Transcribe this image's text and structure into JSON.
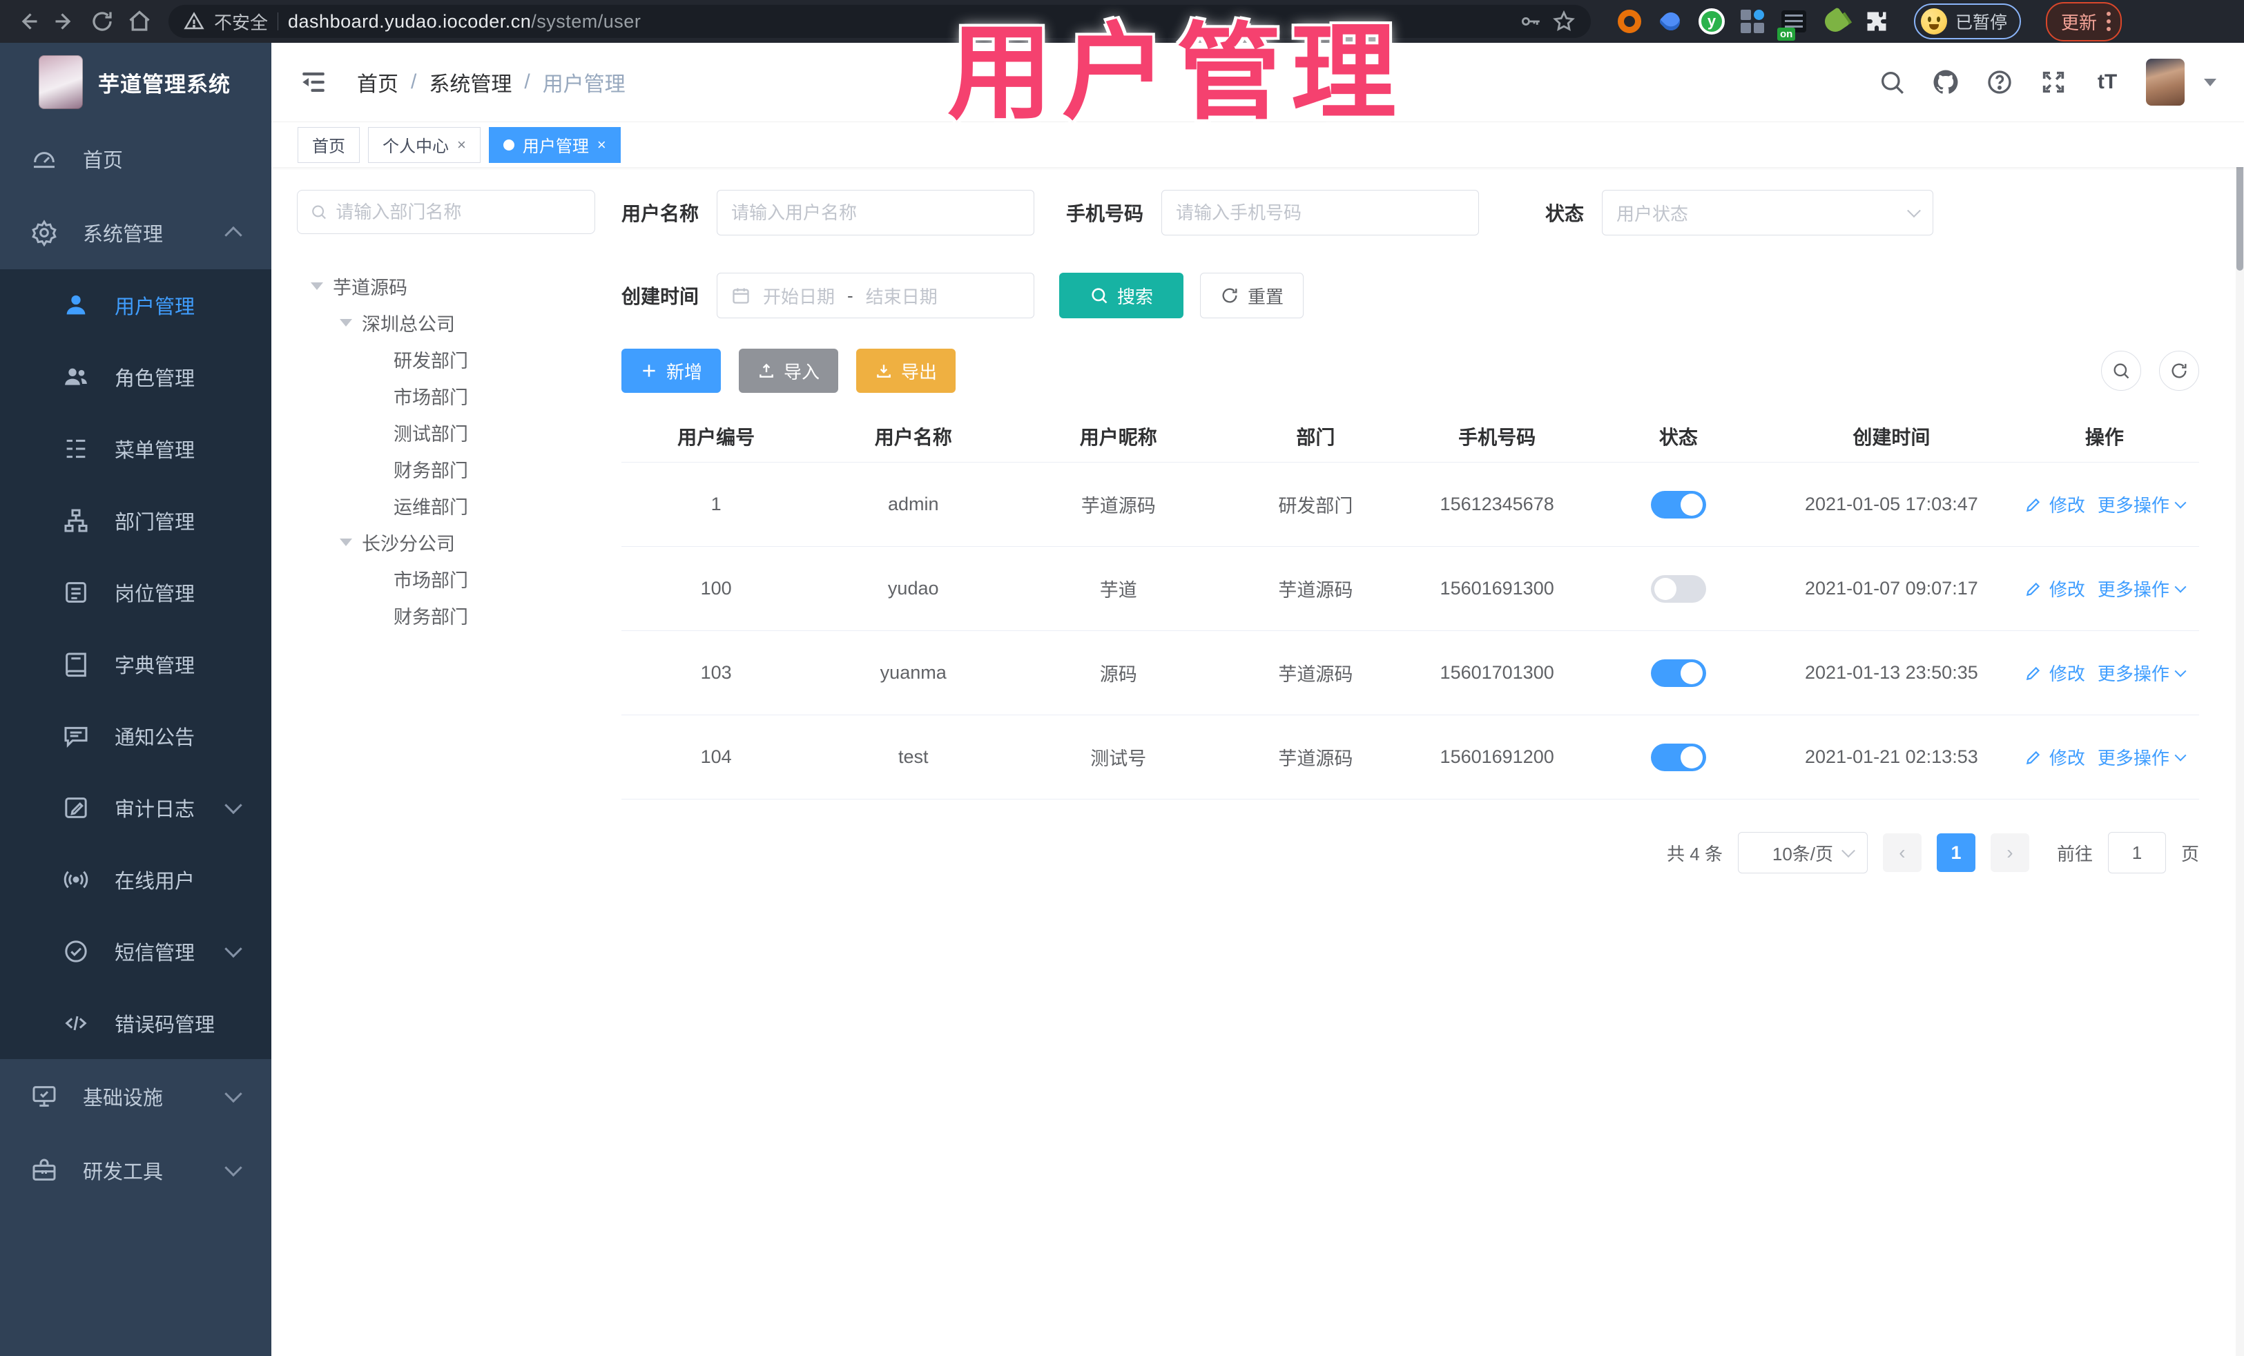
{
  "browser": {
    "security_label": "不安全",
    "url_host": "dashboard.yudao.iocoder.cn",
    "url_path": "/system/user",
    "extension_badge": "on",
    "profile_status_label": "已暂停",
    "update_label": "更新"
  },
  "annotation": {
    "text": "用户管理"
  },
  "colors": {
    "accent": "#409eff",
    "search_button": "#17b3a3",
    "import_button": "#909399",
    "export_button": "#efb041",
    "annotation": "#f5416f",
    "sidebar_bg": "#304156",
    "submenu_bg": "#1f2d3d"
  },
  "sidebar": {
    "app_title": "芋道管理系统",
    "items_top": [
      {
        "label": "首页"
      },
      {
        "label": "系统管理"
      }
    ],
    "submenu": [
      "用户管理",
      "角色管理",
      "菜单管理",
      "部门管理",
      "岗位管理",
      "字典管理",
      "通知公告",
      "审计日志",
      "在线用户",
      "短信管理",
      "错误码管理"
    ],
    "items_bottom": [
      "基础设施",
      "研发工具"
    ]
  },
  "header": {
    "breadcrumb": [
      "首页",
      "系统管理",
      "用户管理"
    ]
  },
  "tabs": {
    "items": [
      {
        "label": "首页"
      },
      {
        "label": "个人中心"
      },
      {
        "label": "用户管理"
      }
    ]
  },
  "dept": {
    "search_placeholder": "请输入部门名称",
    "tree": {
      "label": "芋道源码",
      "children": [
        {
          "label": "深圳总公司",
          "children": [
            "研发部门",
            "市场部门",
            "测试部门",
            "财务部门",
            "运维部门"
          ]
        },
        {
          "label": "长沙分公司",
          "children": [
            "市场部门",
            "财务部门"
          ]
        }
      ]
    }
  },
  "filters": {
    "username_label": "用户名称",
    "username_placeholder": "请输入用户名称",
    "mobile_label": "手机号码",
    "mobile_placeholder": "请输入手机号码",
    "status_label": "状态",
    "status_placeholder": "用户状态",
    "created_label": "创建时间",
    "date_start_placeholder": "开始日期",
    "date_separator": "-",
    "date_end_placeholder": "结束日期",
    "search_label": "搜索",
    "reset_label": "重置"
  },
  "toolbar": {
    "add_label": "新增",
    "import_label": "导入",
    "export_label": "导出"
  },
  "table": {
    "columns": [
      "用户编号",
      "用户名称",
      "用户昵称",
      "部门",
      "手机号码",
      "状态",
      "创建时间",
      "操作"
    ],
    "action_edit": "修改",
    "action_more": "更多操作",
    "rows": [
      {
        "id": "1",
        "username": "admin",
        "nickname": "芋道源码",
        "dept": "研发部门",
        "mobile": "15612345678",
        "status": true,
        "created": "2021-01-05 17:03:47"
      },
      {
        "id": "100",
        "username": "yudao",
        "nickname": "芋道",
        "dept": "芋道源码",
        "mobile": "15601691300",
        "status": false,
        "created": "2021-01-07 09:07:17"
      },
      {
        "id": "103",
        "username": "yuanma",
        "nickname": "源码",
        "dept": "芋道源码",
        "mobile": "15601701300",
        "status": true,
        "created": "2021-01-13 23:50:35"
      },
      {
        "id": "104",
        "username": "test",
        "nickname": "测试号",
        "dept": "芋道源码",
        "mobile": "15601691200",
        "status": true,
        "created": "2021-01-21 02:13:53"
      }
    ]
  },
  "pagination": {
    "total_label": "共 4 条",
    "page_size_label": "10条/页",
    "page": "1",
    "goto_label": "前往",
    "goto_page": "1",
    "unit_label": "页"
  }
}
